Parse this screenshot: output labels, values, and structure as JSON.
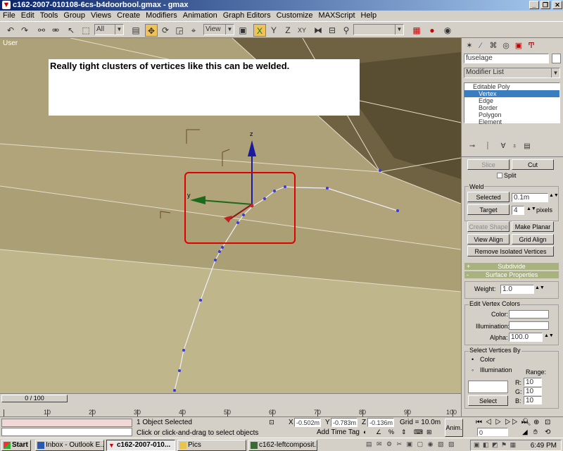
{
  "window": {
    "title": "c162-2007-010108-6cs-b4doorbool.gmax - gmax",
    "minimize": "_",
    "restore": "❐",
    "close": "✕"
  },
  "menu": [
    "File",
    "Edit",
    "Tools",
    "Group",
    "Views",
    "Create",
    "Modifiers",
    "Animation",
    "Graph Editors",
    "Customize",
    "MAXScript",
    "Help"
  ],
  "toolbar": {
    "selection_filter": "All",
    "coord_system": "View",
    "axis_labels": [
      "X",
      "Y",
      "Z",
      "XY"
    ]
  },
  "viewport": {
    "label": "User",
    "callout": "Really tight  clusters of vertices like this can be welded.",
    "axis_z": "z",
    "axis_y": "y"
  },
  "command_panel": {
    "object_name": "fuselage",
    "modifier_list": "Modifier List",
    "stack": {
      "root": "Editable Poly",
      "items": [
        "Vertex",
        "Edge",
        "Border",
        "Polygon",
        "Element"
      ],
      "selected": "Vertex"
    },
    "slice_label": "Slice",
    "cut_label": "Cut",
    "split_label": "Split",
    "weld_group": "Weld",
    "weld_selected": "Selected",
    "weld_threshold": "0.1m",
    "weld_target": "Target",
    "target_pixels": "4",
    "pixels_label": "pixels",
    "create_shape": "Create Shape",
    "make_planar": "Make Planar",
    "view_align": "View Align",
    "grid_align": "Grid Align",
    "remove_isolated": "Remove Isolated Vertices",
    "subdivide": "Subdivide",
    "surface_props": "Surface Properties",
    "weight_label": "Weight:",
    "weight_value": "1.0",
    "edit_vertex_colors": "Edit Vertex Colors",
    "color_label": "Color:",
    "illumination_label": "Illumination:",
    "alpha_label": "Alpha:",
    "alpha_value": "100.0",
    "select_by": "Select Vertices By",
    "select_color": "Color",
    "select_illum": "Illumination",
    "range_label": "Range:",
    "r_label": "R:",
    "g_label": "G:",
    "b_label": "B:",
    "r_value": "10",
    "g_value": "10",
    "b_value": "10",
    "select_button": "Select",
    "plus": "+",
    "minus": "-"
  },
  "timeline": {
    "slider": "0 / 100",
    "ticks": [
      "10",
      "20",
      "30",
      "40",
      "50",
      "60",
      "70",
      "80",
      "90",
      "100"
    ]
  },
  "status": {
    "objects": "1 Object Selected",
    "prompt": "Click or click-and-drag to select objects",
    "x": "-0.502m",
    "y": "-0.783m",
    "z": "-0.136m",
    "grid": "Grid = 10.0m",
    "add_time_tag": "Add Time Tag",
    "anim": "Anim.",
    "frame": "0",
    "x_label": "X",
    "y_label": "Y",
    "z_label": "Z"
  },
  "taskbar": {
    "start": "Start",
    "tasks": [
      "Inbox - Outlook E...",
      "c162-2007-010...",
      "Pics",
      "c162-leftcomposit..."
    ],
    "clock": "6:49 PM"
  }
}
